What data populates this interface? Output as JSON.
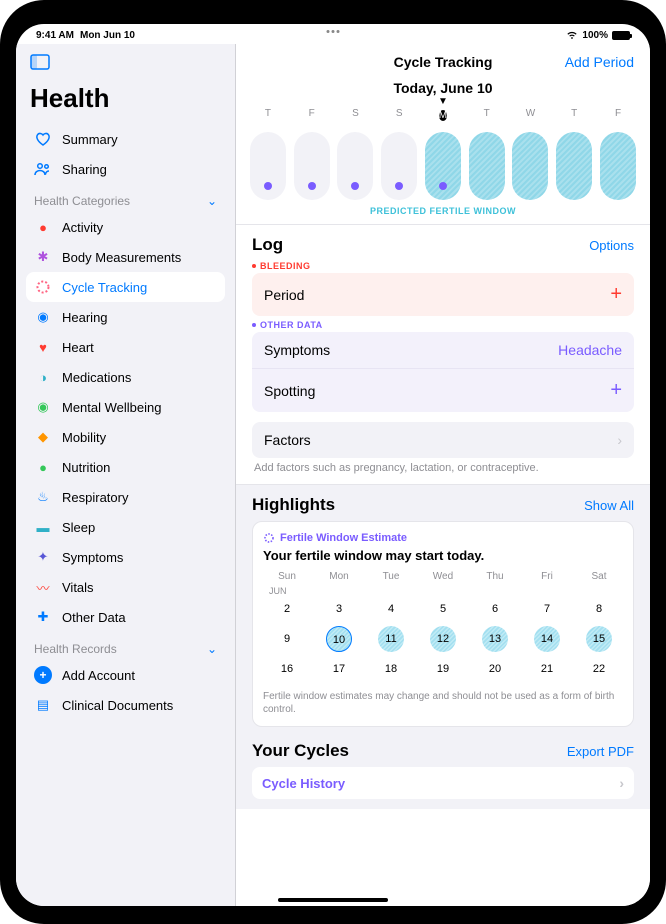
{
  "status": {
    "time": "9:41 AM",
    "date": "Mon Jun 10",
    "battery": "100%"
  },
  "sidebar": {
    "title": "Health",
    "top": [
      {
        "label": "Summary"
      },
      {
        "label": "Sharing"
      }
    ],
    "categories_header": "Health Categories",
    "categories": [
      {
        "label": "Activity"
      },
      {
        "label": "Body Measurements"
      },
      {
        "label": "Cycle Tracking"
      },
      {
        "label": "Hearing"
      },
      {
        "label": "Heart"
      },
      {
        "label": "Medications"
      },
      {
        "label": "Mental Wellbeing"
      },
      {
        "label": "Mobility"
      },
      {
        "label": "Nutrition"
      },
      {
        "label": "Respiratory"
      },
      {
        "label": "Sleep"
      },
      {
        "label": "Symptoms"
      },
      {
        "label": "Vitals"
      },
      {
        "label": "Other Data"
      }
    ],
    "records_header": "Health Records",
    "records": [
      {
        "label": "Add Account"
      },
      {
        "label": "Clinical Documents"
      }
    ]
  },
  "content": {
    "header": {
      "title": "Cycle Tracking",
      "action": "Add Period"
    },
    "today": "Today, June 10",
    "week_days": [
      "T",
      "F",
      "S",
      "S",
      "M",
      "T",
      "W",
      "T",
      "F"
    ],
    "fertile_label": "PREDICTED FERTILE WINDOW",
    "log": {
      "title": "Log",
      "options": "Options",
      "bleeding_label": "BLEEDING",
      "period": "Period",
      "other_label": "OTHER DATA",
      "symptoms": "Symptoms",
      "symptoms_value": "Headache",
      "spotting": "Spotting",
      "factors": "Factors",
      "factors_hint": "Add factors such as pregnancy, lactation, or contraceptive."
    },
    "highlights": {
      "title": "Highlights",
      "show_all": "Show All",
      "tag": "Fertile Window Estimate",
      "headline": "Your fertile window may start today.",
      "days_header": [
        "Sun",
        "Mon",
        "Tue",
        "Wed",
        "Thu",
        "Fri",
        "Sat"
      ],
      "month": "JUN",
      "grid": [
        [
          2,
          3,
          4,
          5,
          6,
          7,
          8
        ],
        [
          9,
          10,
          11,
          12,
          13,
          14,
          15
        ],
        [
          16,
          17,
          18,
          19,
          20,
          21,
          22
        ]
      ],
      "fertile_days": [
        10,
        11,
        12,
        13,
        14,
        15
      ],
      "today_day": 10,
      "disclaimer": "Fertile window estimates may change and should not be used as a form of birth control."
    },
    "cycles": {
      "title": "Your Cycles",
      "export": "Export PDF",
      "row1": "Cycle History"
    }
  }
}
